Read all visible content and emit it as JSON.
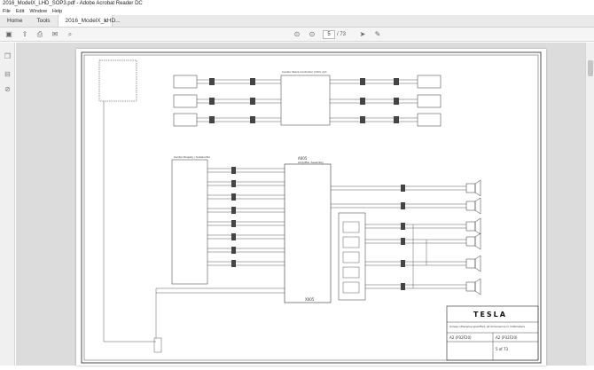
{
  "window": {
    "title": "2016_ModelX_LHD_SOP3.pdf - Adobe Acrobat Reader DC"
  },
  "menu": {
    "file": "File",
    "edit": "Edit",
    "window": "Window",
    "help": "Help"
  },
  "tabs": {
    "home": "Home",
    "tools": "Tools",
    "document": "2016_ModelX_LHD..."
  },
  "toolbar": {
    "page_current": "5",
    "page_total": "/ 73"
  },
  "drawing": {
    "brand": "TESLA",
    "header_label": "Center Stack Controller (CSC) A/C",
    "amp_label": "Amplifier Assembly",
    "amp_id": "A005",
    "connector_id": "X005",
    "dist_label": "Center Display / Subwoofer",
    "notes": "Unless otherwise specified, all dimensions in millimeters",
    "rev": "A2 (P32F20)",
    "rev2": "A2 (P32F20)",
    "sheet": "5 of 73"
  }
}
